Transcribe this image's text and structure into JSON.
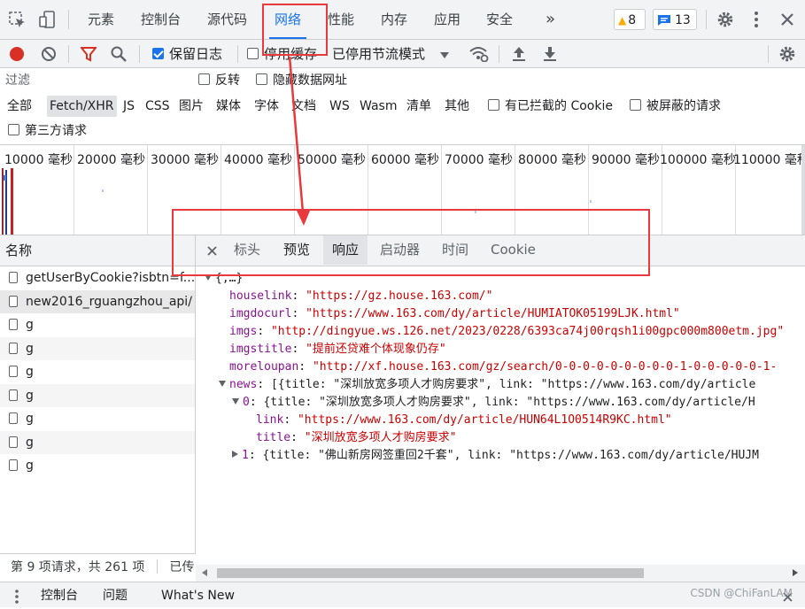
{
  "top_tabs": [
    "元素",
    "控制台",
    "源代码",
    "网络",
    "性能",
    "内存",
    "应用",
    "安全"
  ],
  "top_tab_selected": "网络",
  "more_tabs": "»",
  "warning_count": "8",
  "message_count": "13",
  "toolbar": {
    "preserve_log": "保留日志",
    "preserve_log_checked": true,
    "disable_cache": "停用缓存",
    "disable_cache_checked": false,
    "throttle": "已停用节流模式"
  },
  "filter": {
    "placeholder": "过滤",
    "invert": "反转",
    "hide_data_urls": "隐藏数据网址"
  },
  "types": [
    "全部",
    "Fetch/XHR",
    "JS",
    "CSS",
    "图片",
    "媒体",
    "字体",
    "文档",
    "WS",
    "Wasm",
    "清单",
    "其他"
  ],
  "type_selected": "Fetch/XHR",
  "blocked_cookies": "有已拦截的 Cookie",
  "blocked_requests": "被屏蔽的请求",
  "third_party": "第三方请求",
  "timeline_ticks": [
    "10000 毫秒",
    "20000 毫秒",
    "30000 毫秒",
    "40000 毫秒",
    "50000 毫秒",
    "60000 毫秒",
    "70000 毫秒",
    "80000 毫秒",
    "90000 毫秒",
    "100000 毫秒",
    "110000 毫秒"
  ],
  "name_header": "名称",
  "requests": [
    "getUserByCookie?isbtn=f...",
    "new2016_rguangzhou_api/",
    "g",
    "g",
    "g",
    "g",
    "g",
    "g",
    "g"
  ],
  "selected_request": "new2016_rguangzhou_api/",
  "status_text": "第 9 项请求，共 261 项",
  "status_extra": "已传",
  "detail_tabs": [
    "标头",
    "预览",
    "响应",
    "启动器",
    "时间",
    "Cookie"
  ],
  "detail_tab_selected": "响应",
  "preview": {
    "root": "{,…}",
    "houselink_key": "houselink",
    "houselink_val": "\"https://gz.house.163.com/\"",
    "imgdocurl_key": "imgdocurl",
    "imgdocurl_val": "\"https://www.163.com/dy/article/HUMIATOK05199LJK.html\"",
    "imgs_key": "imgs",
    "imgs_val": "\"http://dingyue.ws.126.net/2023/0228/6393ca74j00rqsh1i00gpc000m800etm.jpg\"",
    "imgstitle_key": "imgstitle",
    "imgstitle_val": "\"提前还贷难个体现象仍存\"",
    "moreloupan_key": "moreloupan",
    "moreloupan_val": "\"http://xf.house.163.com/gz/search/0-0-0-0-0-0-0-0-0-1-0-0-0-0-0-1-",
    "news_key": "news",
    "news_val": "[{title: \"深圳放宽多项人才购房要求\", link: \"https://www.163.com/dy/article",
    "item0_key": "0",
    "item0_val": "{title: \"深圳放宽多项人才购房要求\", link: \"https://www.163.com/dy/article/H",
    "link_key": "link",
    "link_val": "\"https://www.163.com/dy/article/HUN64L1O0514R9KC.html\"",
    "title_key": "title",
    "title_val": "\"深圳放宽多项人才购房要求\"",
    "item1_key": "1",
    "item1_val": "{title: \"佛山新房网签重回2千套\", link: \"https://www.163.com/dy/article/HUJM"
  },
  "drawer": {
    "console": "控制台",
    "issues": "问题",
    "whats_new": "What's New"
  },
  "watermark": "CSDN @ChiFanLAM",
  "colors": {
    "accent": "#1a73e8",
    "annotation_red": "#e8393c",
    "record_red": "#d93025"
  }
}
